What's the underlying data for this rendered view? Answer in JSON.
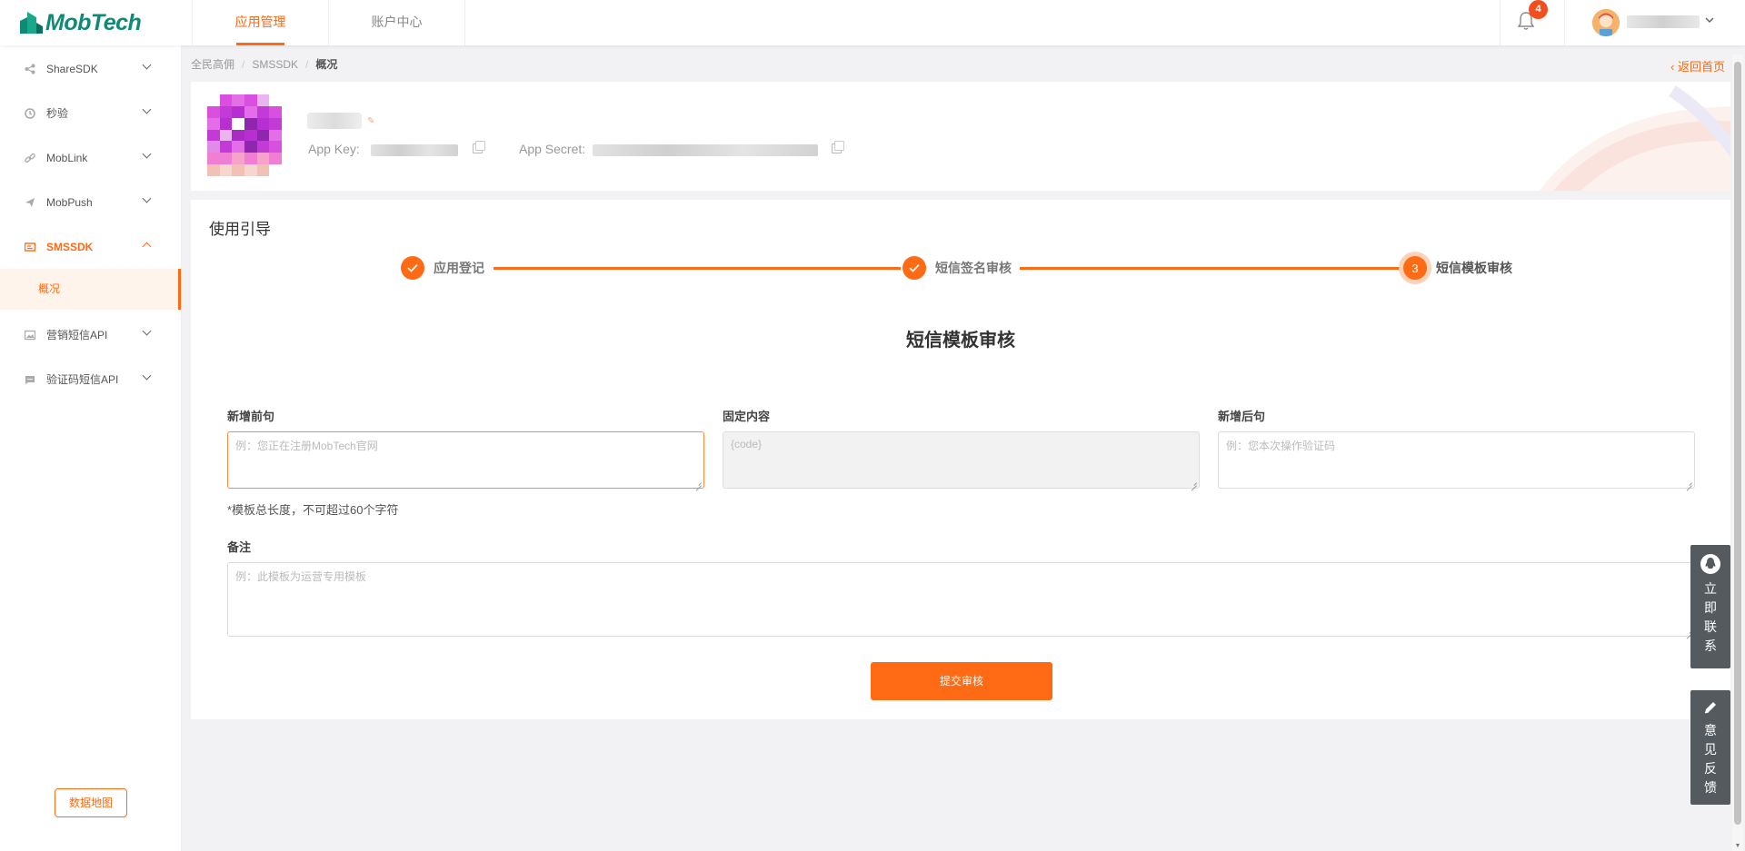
{
  "brand": {
    "name": "MobTech",
    "color": "#0f8a74",
    "accent": "#ff6a14"
  },
  "topnav": {
    "items": [
      {
        "label": "应用管理",
        "active": true
      },
      {
        "label": "账户中心",
        "active": false
      }
    ]
  },
  "header": {
    "notification_count": "4"
  },
  "sidebar": {
    "items": [
      {
        "label": "ShareSDK",
        "icon": "share-icon"
      },
      {
        "label": "秒验",
        "icon": "clock-icon"
      },
      {
        "label": "MobLink",
        "icon": "link-icon"
      },
      {
        "label": "MobPush",
        "icon": "send-icon"
      },
      {
        "label": "SMSSDK",
        "icon": "sms-icon",
        "open": true,
        "children": [
          {
            "label": "概况"
          }
        ]
      },
      {
        "label": "营销短信API",
        "icon": "image-icon"
      },
      {
        "label": "验证码短信API",
        "icon": "message-icon"
      }
    ],
    "map_button": "数据地图"
  },
  "breadcrumb": {
    "items": [
      "全民高佣",
      "SMSSDK",
      "概况"
    ],
    "back_home": "返回首页"
  },
  "app": {
    "app_key_label": "App Key:",
    "app_secret_label": "App Secret:"
  },
  "guide": {
    "title": "使用引导",
    "steps": [
      {
        "label": "应用登记",
        "status": "done"
      },
      {
        "label": "短信签名审核",
        "status": "done"
      },
      {
        "label": "短信模板审核",
        "status": "current",
        "number": "3"
      }
    ],
    "section_title": "短信模板审核",
    "fields": {
      "prefix": {
        "label": "新增前句",
        "placeholder": "例：您正在注册MobTech官网"
      },
      "fixed": {
        "label": "固定内容",
        "placeholder": "{code}"
      },
      "suffix": {
        "label": "新增后句",
        "placeholder": "例：您本次操作验证码"
      },
      "remark": {
        "label": "备注",
        "placeholder": "例：此模板为运营专用模板"
      }
    },
    "length_hint": "*模板总长度，不可超过60个字符",
    "submit": "提交审核"
  },
  "float": {
    "contact": "立即联系",
    "feedback": "意见反馈"
  }
}
